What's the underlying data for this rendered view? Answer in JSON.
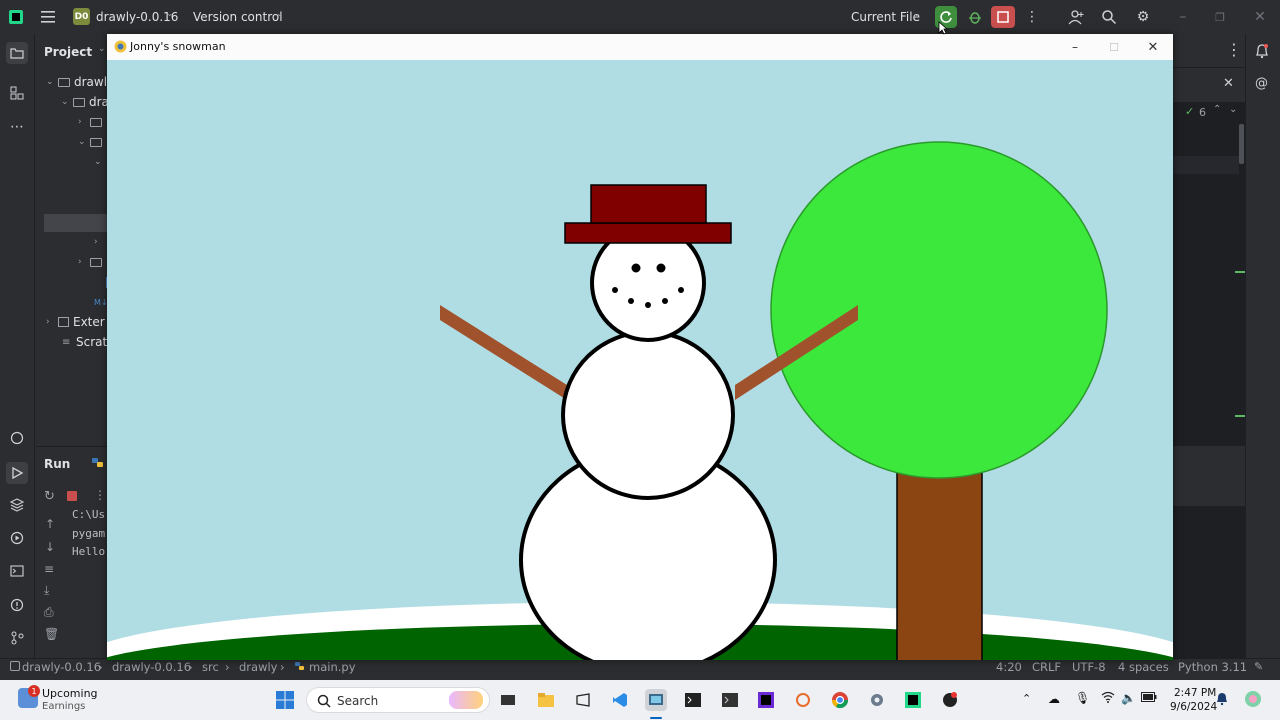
{
  "ide": {
    "project_badge": "D0",
    "project_name": "drawly-0.0.16",
    "vcs_label": "Version control",
    "run_config": "Current File",
    "project_panel_title": "Project",
    "tree": [
      {
        "label": "drawl"
      },
      {
        "label": "dra"
      },
      {
        "label": ""
      },
      {
        "label": ""
      },
      {
        "label": "Exter"
      },
      {
        "label": "Scratc"
      }
    ],
    "run_tab": "Run",
    "console_lines": [
      "C:\\Us",
      "pygam",
      "Hello"
    ],
    "check_count": "6"
  },
  "status_bar": {
    "breadcrumbs": [
      "drawly-0.0.16",
      "drawly-0.0.16",
      "src",
      "drawly",
      "main.py"
    ],
    "position": "4:20",
    "line_sep": "CRLF",
    "encoding": "UTF-8",
    "indent": "4 spaces",
    "interpreter": "Python 3.11"
  },
  "game_window": {
    "title": "Jonny's snowman",
    "colors": {
      "sky": "#b0dde4",
      "grass": "#006400",
      "snow": "#ffffff",
      "hat": "#800000",
      "arm": "#a0522d",
      "trunk": "#8b4513",
      "canopy": "#3ce83c"
    }
  },
  "taskbar": {
    "weather_badge": "1",
    "weather_title": "Upcoming",
    "weather_sub": "Earnings",
    "search_label": "Search",
    "time": "2:47 PM",
    "date": "9/6/2024"
  }
}
